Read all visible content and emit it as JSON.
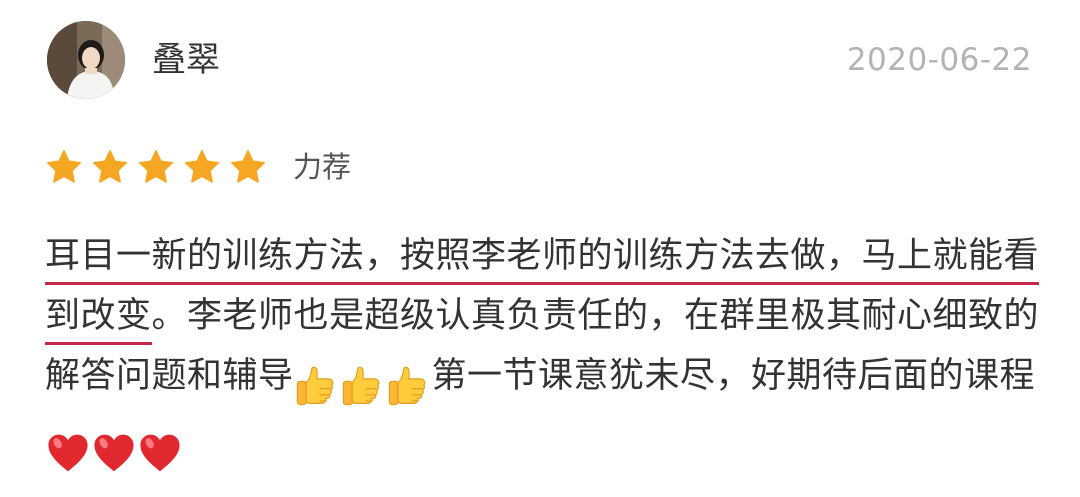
{
  "reviewer": {
    "name": "叠翠",
    "date": "2020-06-22"
  },
  "rating": {
    "stars": 5,
    "max_stars": 5,
    "label": "力荐",
    "star_color": "#f5a623"
  },
  "review": {
    "highlighted_text": "耳目一新的训练方法，按照李老师的训练方法去做，马上就能看到改变",
    "text_part_1": "。李老师也是超级认真负责任的，在群里极其耐心细致的解答问题和辅导",
    "text_part_2": "第一节课意犹未尽，好期待后面的课程",
    "emoji_group_1": [
      "thumbs-up",
      "thumbs-up",
      "thumbs-up"
    ],
    "emoji_group_2": [
      "red-heart",
      "red-heart",
      "red-heart"
    ],
    "highlight_color": "#c8264a"
  }
}
